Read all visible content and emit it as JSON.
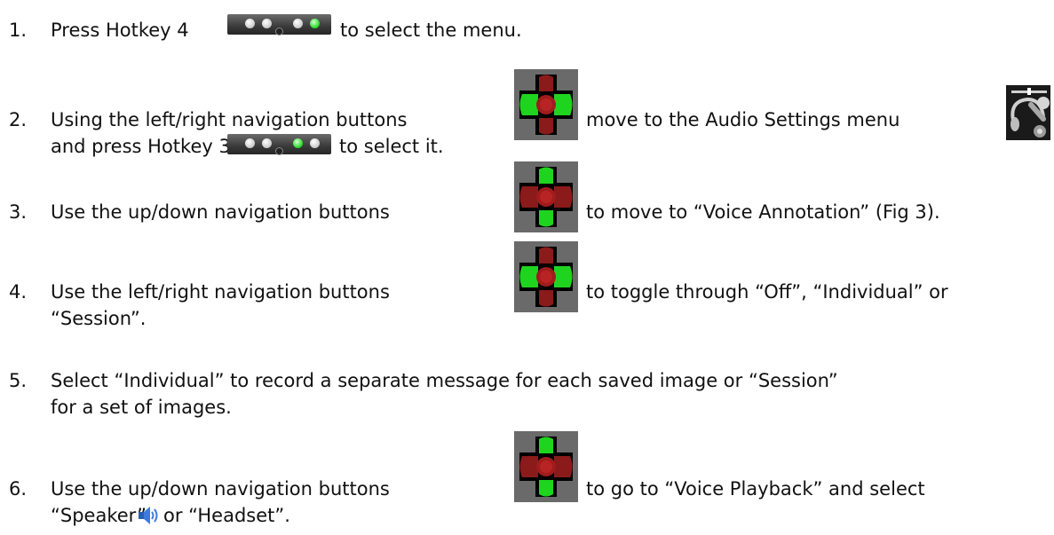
{
  "steps": [
    {
      "num": "1.",
      "parts": [
        "Press Hotkey 4",
        "to select the menu."
      ]
    },
    {
      "num": "2.",
      "parts": [
        "Using the left/right navigation buttons",
        "move to the Audio Settings menu",
        "and press Hotkey 3",
        "to select it."
      ]
    },
    {
      "num": "3.",
      "parts": [
        "Use the up/down navigation buttons",
        "to move to “Voice Annotation” (Fig 3)."
      ]
    },
    {
      "num": "4.",
      "parts": [
        "Use the left/right navigation buttons",
        "to toggle through “Off”, “Individual” or",
        "“Session”."
      ]
    },
    {
      "num": "5.",
      "parts": [
        "Select “Individual” to record a separate message for each saved image or “Session”",
        "for a set of images."
      ]
    },
    {
      "num": "6.",
      "parts": [
        "Use the up/down navigation buttons",
        "to go to “Voice Playback” and select",
        "“Speaker”",
        "or “Headset”."
      ]
    }
  ],
  "icons": {
    "hotkey_4": "hotkey-4-icon",
    "hotkey_3": "hotkey-3-icon",
    "nav_left_right": "left-right-navigation-icon",
    "nav_up_down": "up-down-navigation-icon",
    "audio_settings": "audio-settings-icon",
    "speaker": "speaker-icon"
  },
  "colors": {
    "text": "#111111",
    "nav_red": "#8b1a1a",
    "nav_green": "#1fd41f",
    "hotkey_green": "#33e035"
  }
}
